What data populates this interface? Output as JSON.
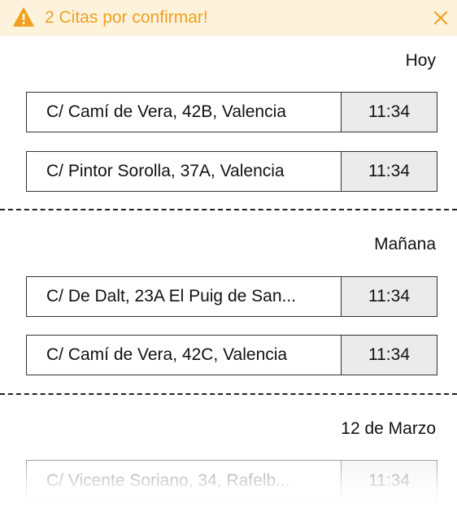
{
  "alert": {
    "text": "2 Citas por confirmar!",
    "icon": "warning-triangle-icon",
    "close_icon": "close-icon",
    "color": "#f0a020",
    "background": "#fdf3dc"
  },
  "sections": [
    {
      "title": "Hoy",
      "appointments": [
        {
          "address": "C/ Camí de Vera, 42B, Valencia",
          "time": "11:34"
        },
        {
          "address": "C/ Pintor Sorolla, 37A, Valencia",
          "time": "11:34"
        }
      ]
    },
    {
      "title": "Mañana",
      "appointments": [
        {
          "address": "C/ De Dalt, 23A El Puig de San...",
          "time": "11:34"
        },
        {
          "address": "C/ Camí de Vera, 42C, Valencia",
          "time": "11:34"
        }
      ]
    },
    {
      "title": "12 de Marzo",
      "appointments": [
        {
          "address": "C/ Vicente Soriano, 34, Rafelb...",
          "time": "11:34"
        }
      ]
    }
  ]
}
